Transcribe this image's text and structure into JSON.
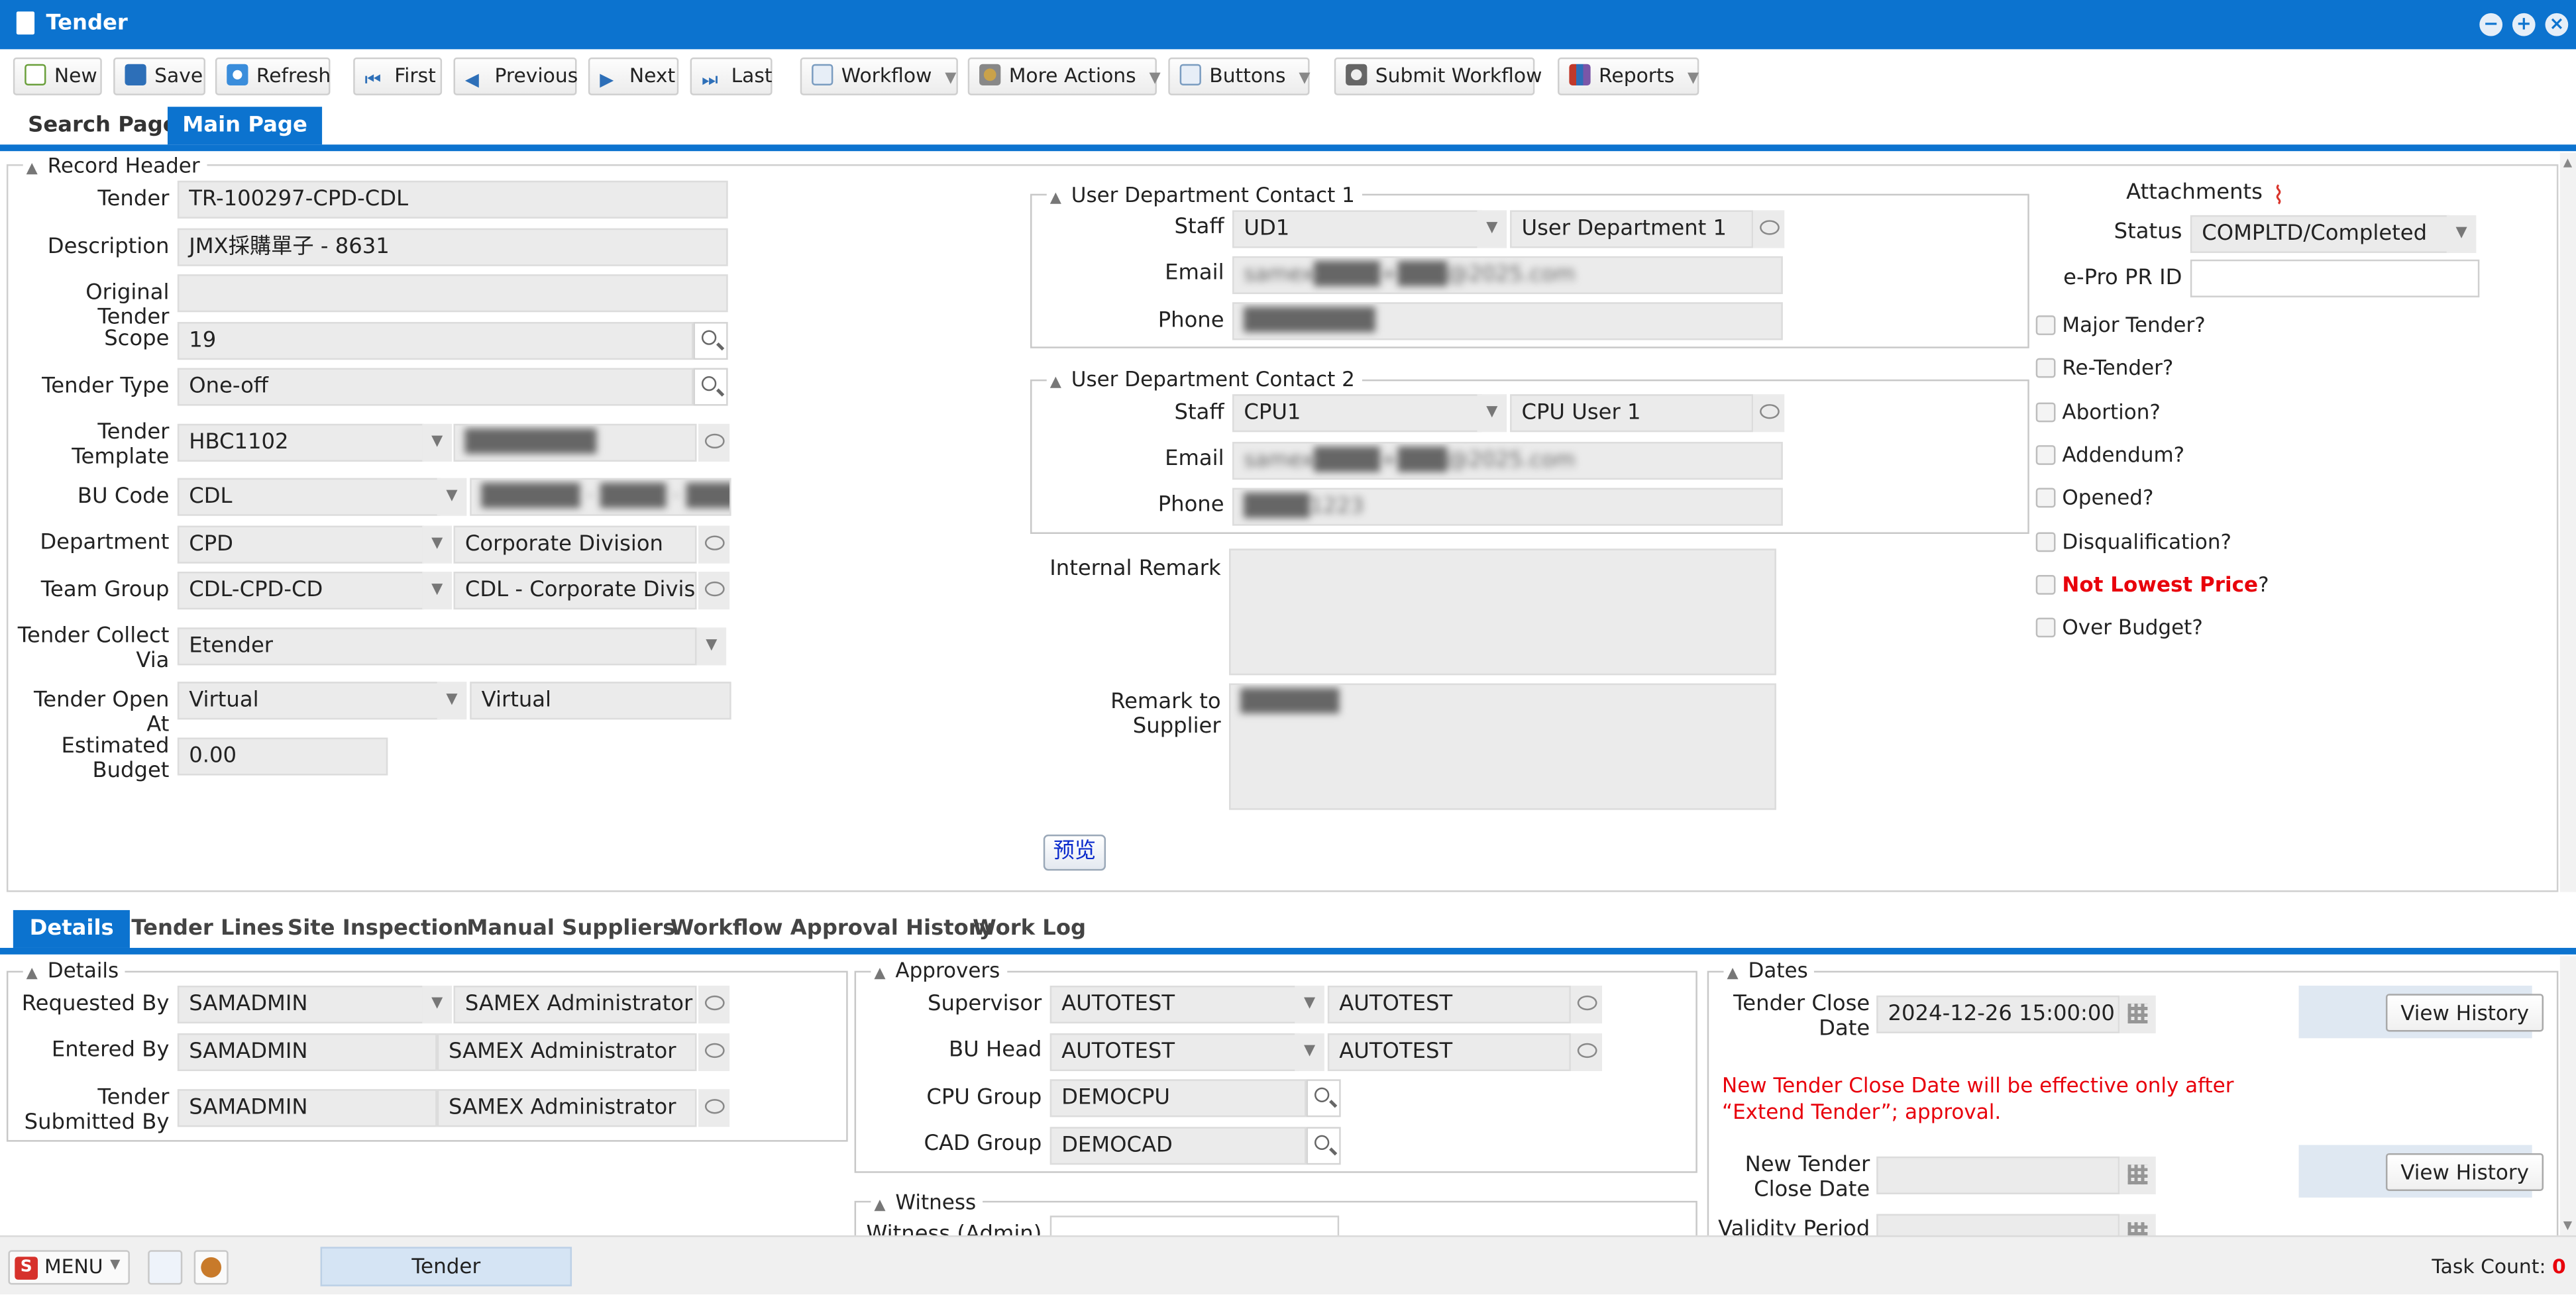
{
  "window": {
    "title": "Tender"
  },
  "toolbar": {
    "new": "New",
    "save": "Save",
    "refresh": "Refresh",
    "first": "First",
    "previous": "Previous",
    "next": "Next",
    "last": "Last",
    "workflow": "Workflow",
    "more_actions": "More Actions",
    "buttons": "Buttons",
    "submit_workflow": "Submit Workflow",
    "reports": "Reports"
  },
  "page_tabs": [
    "Search Page",
    "Main Page"
  ],
  "record_header": {
    "title": "Record Header",
    "tender_label": "Tender",
    "tender": "TR-100297-CPD-CDL",
    "description_label": "Description",
    "description": "JMX採購單子 - 8631",
    "original_tender_label": "Original Tender",
    "original_tender": "",
    "scope_label": "Scope",
    "scope": "19",
    "tender_type_label": "Tender Type",
    "tender_type": "One-off",
    "tender_template_label_1": "Tender",
    "tender_template_label_2": "Template",
    "tender_template": "HBC1102",
    "tender_template_desc": "████████",
    "bu_code_label": "BU Code",
    "bu_code": "CDL",
    "bu_code_desc": "██████ · ████ · ███",
    "department_label": "Department",
    "department": "CPD",
    "department_desc": "Corporate Division",
    "team_group_label": "Team Group",
    "team_group": "CDL-CPD-CD",
    "team_group_desc": "CDL - Corporate Division",
    "collect_via_label_1": "Tender Collect",
    "collect_via_label_2": "Via",
    "collect_via": "Etender",
    "open_at_label": "Tender Open At",
    "open_at": "Virtual",
    "open_at_desc": "Virtual",
    "budget_label_1": "Estimated",
    "budget_label_2": "Budget",
    "budget": "0.00"
  },
  "contact1": {
    "title": "User Department Contact 1",
    "staff_label": "Staff",
    "staff": "UD1",
    "staff_name": "User Department 1",
    "email_label": "Email",
    "email": "samex████+███@2025.com",
    "phone_label": "Phone",
    "phone": "████████"
  },
  "contact2": {
    "title": "User Department Contact 2",
    "staff_label": "Staff",
    "staff": "CPU1",
    "staff_name": "CPU User 1",
    "email_label": "Email",
    "email": "samex████+███@2025.com",
    "phone_label": "Phone",
    "phone": "████1223"
  },
  "remarks": {
    "internal_label": "Internal Remark",
    "internal": "",
    "supplier_label": "Remark to Supplier",
    "supplier": "██████",
    "preview_button": "预览"
  },
  "side": {
    "attachments_label": "Attachments",
    "status_label": "Status",
    "status": "COMPLTD/Completed",
    "epro_label": "e-Pro PR ID",
    "epro": "",
    "checks": [
      {
        "label": "Major Tender?",
        "red": false
      },
      {
        "label": "Re-Tender?",
        "red": false
      },
      {
        "label": "Abortion?",
        "red": false
      },
      {
        "label": "Addendum?",
        "red": false
      },
      {
        "label": "Opened?",
        "red": false
      },
      {
        "label": "Disqualification?",
        "red": false
      },
      {
        "label": "Not Lowest Price",
        "red": true
      },
      {
        "label": "Over Budget?",
        "red": false
      }
    ]
  },
  "sub_tabs": [
    "Details",
    "Tender Lines",
    "Site Inspection",
    "Manual Suppliers",
    "Workflow Approval History",
    "Work Log"
  ],
  "details": {
    "title": "Details",
    "requested_by_label": "Requested By",
    "requested_by": "SAMADMIN",
    "requested_by_name": "SAMEX Administrator",
    "entered_by_label": "Entered By",
    "entered_by": "SAMADMIN",
    "entered_by_name": "SAMEX Administrator",
    "submitted_by_label_1": "Tender",
    "submitted_by_label_2": "Submitted By",
    "submitted_by": "SAMADMIN",
    "submitted_by_name": "SAMEX Administrator"
  },
  "approvers": {
    "title": "Approvers",
    "supervisor_label": "Supervisor",
    "supervisor": "AUTOTEST",
    "supervisor_name": "AUTOTEST",
    "bu_head_label": "BU Head",
    "bu_head": "AUTOTEST",
    "bu_head_name": "AUTOTEST",
    "cpu_group_label": "CPU Group",
    "cpu_group": "DEMOCPU",
    "cad_group_label": "CAD Group",
    "cad_group": "DEMOCAD"
  },
  "witness": {
    "title": "Witness",
    "admin_label": "Witness (Admin)",
    "admin": ""
  },
  "dates": {
    "title": "Dates",
    "close_date_label_1": "Tender Close",
    "close_date_label_2": "Date",
    "close_date": "2024-12-26 15:00:00",
    "view_history": "View History",
    "notice_1": "New Tender Close Date will be effective only after",
    "notice_2": "“Extend Tender”; approval.",
    "new_close_label_1": "New Tender",
    "new_close_label_2": "Close Date",
    "new_close_date": "",
    "validity_label": "Validity Period"
  },
  "status_bar": {
    "menu": "MENU",
    "open_window": "Tender",
    "task_count_label": "Task Count:",
    "task_count": "0"
  },
  "colors": {
    "accent": "#0c73cf",
    "red": "#e8000b"
  }
}
